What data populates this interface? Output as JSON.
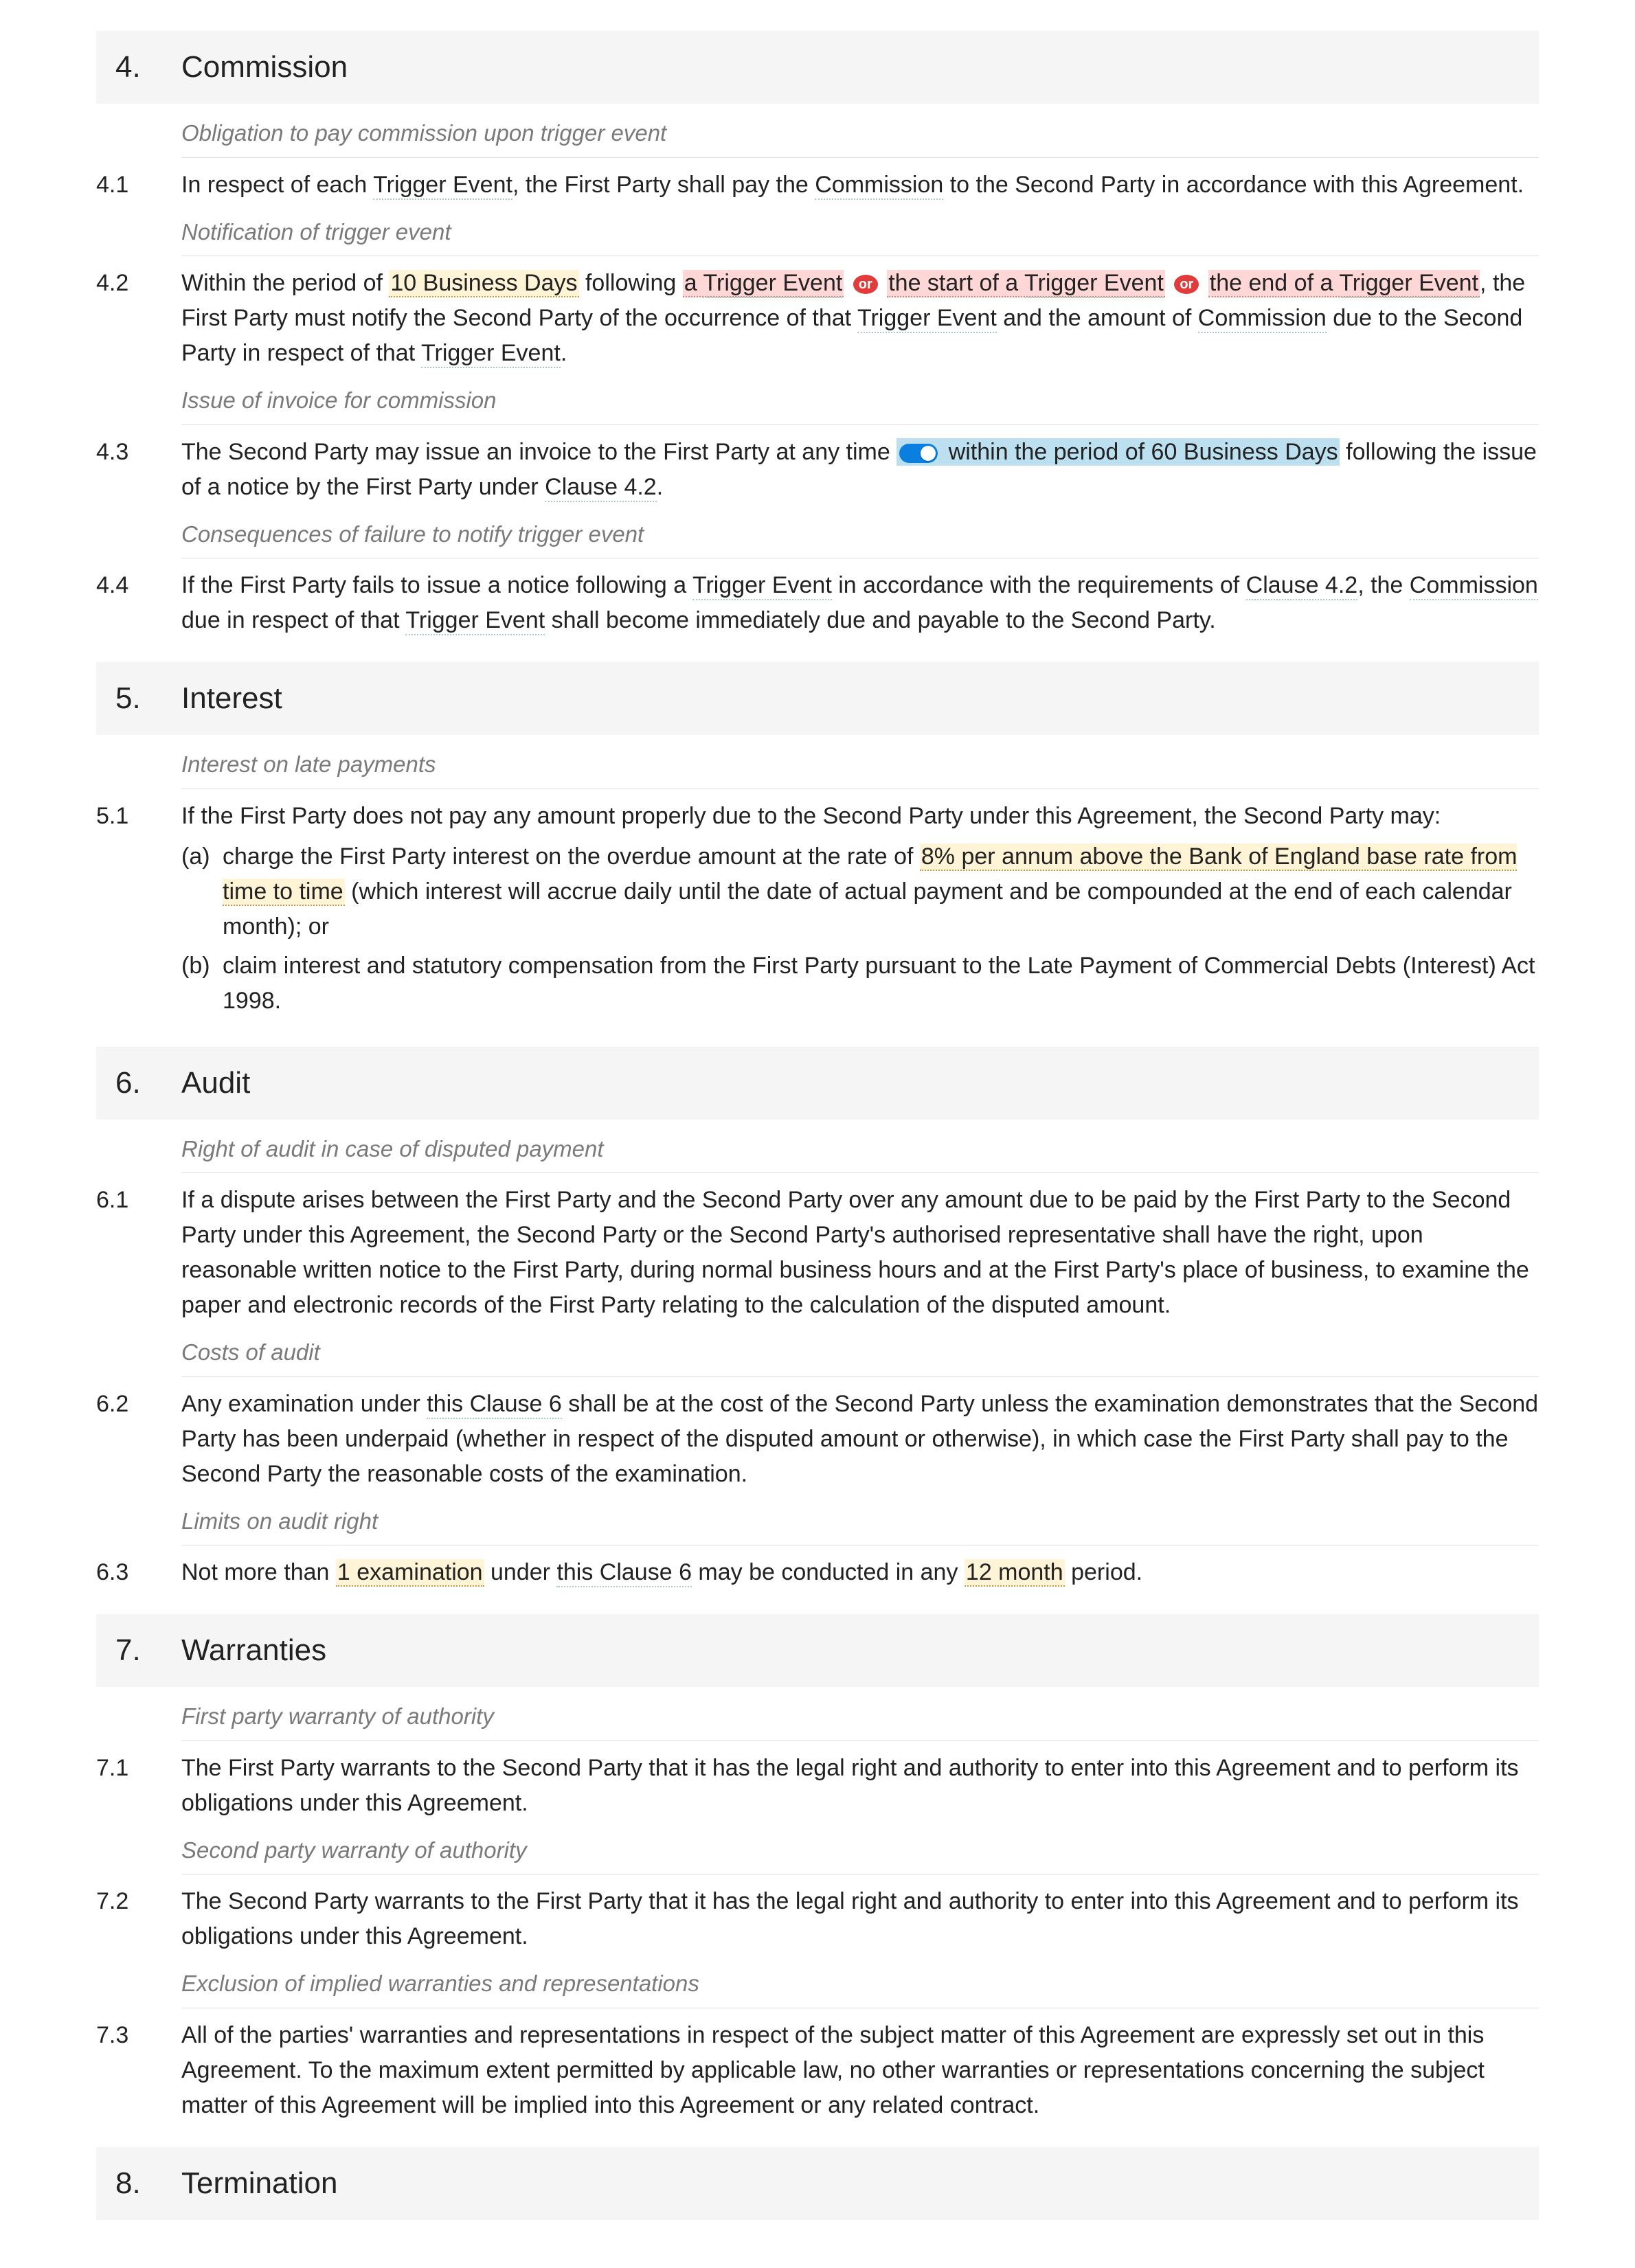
{
  "common": {
    "or_label": "or"
  },
  "s4": {
    "num": "4.",
    "title": "Commission",
    "sub_a": "Obligation to pay commission upon trigger event",
    "c1": {
      "num": "4.1",
      "t1": "In respect of each ",
      "te1": "Trigger Event",
      "t2": ", the First Party shall pay the ",
      "te2": "Commission",
      "t3": " to the Second Party in accordance with this Agreement."
    },
    "sub_b": "Notification of trigger event",
    "c2": {
      "num": "4.2",
      "t1": "Within the period of ",
      "v1": "10 Business Days",
      "t2": " following ",
      "altA_pre": "a ",
      "altA_term": "Trigger Event",
      "altB_pre": "the start of a ",
      "altB_term": "Trigger Event",
      "altC_pre": "the end of a ",
      "altC_term": "Trigger Event",
      "t3": ", the First Party must notify the Second Party of the occurrence of that ",
      "te3": "Trigger Event",
      "t4": " and the amount of ",
      "te4": "Commission",
      "t5": " due to the Second Party in respect of that ",
      "te5": "Trigger Event",
      "t6": "."
    },
    "sub_c": "Issue of invoice for commission",
    "c3": {
      "num": "4.3",
      "t1": "The Second Party may issue an invoice to the First Party at any time ",
      "opt1": "within the period of 60 Business Days",
      "t2": " following the issue of a notice by the First Party under ",
      "ref1": "Clause 4.2",
      "t3": "."
    },
    "sub_d": "Consequences of failure to notify trigger event",
    "c4": {
      "num": "4.4",
      "t1": "If the First Party fails to issue a notice following a ",
      "te1": "Trigger Event",
      "t2": " in accordance with the requirements of ",
      "ref1": "Clause 4.2",
      "t3": ", the ",
      "te2": "Commission",
      "t4": " due in respect of that ",
      "te3": "Trigger Event",
      "t5": " shall become immediately due and payable to the Second Party."
    }
  },
  "s5": {
    "num": "5.",
    "title": "Interest",
    "sub_a": "Interest on late payments",
    "c1": {
      "num": "5.1",
      "lead": "If the First Party does not pay any amount properly due to the Second Party under this Agreement, the Second Party may:",
      "a": {
        "label": "(a)",
        "t1": "charge the First Party interest on the overdue amount at the rate of ",
        "v1": "8% per annum above the Bank of England base rate from time to time",
        "t2": " (which interest will accrue daily until the date of actual payment and be compounded at the end of each calendar month); or"
      },
      "b": {
        "label": "(b)",
        "text": "claim interest and statutory compensation from the First Party pursuant to the Late Payment of Commercial Debts (Interest) Act 1998."
      }
    }
  },
  "s6": {
    "num": "6.",
    "title": "Audit",
    "sub_a": "Right of audit in case of disputed payment",
    "c1": {
      "num": "6.1",
      "text": "If a dispute arises between the First Party and the Second Party over any amount due to be paid by the First Party to the Second Party under this Agreement, the Second Party or the Second Party's authorised representative shall have the right, upon reasonable written notice to the First Party, during normal business hours and at the First Party's place of business, to examine the paper and electronic records of the First Party relating to the calculation of the disputed amount."
    },
    "sub_b": "Costs of audit",
    "c2": {
      "num": "6.2",
      "t1": "Any examination under ",
      "ref1": "this Clause 6",
      "t2": " shall be at the cost of the Second Party unless the examination demonstrates that the Second Party has been underpaid (whether in respect of the disputed amount or otherwise), in which case the First Party shall pay to the Second Party the reasonable costs of the examination."
    },
    "sub_c": "Limits on audit right",
    "c3": {
      "num": "6.3",
      "t1": "Not more than ",
      "v1": "1 examination",
      "t2": " under ",
      "ref1": "this Clause 6",
      "t3": " may be conducted in any ",
      "v2": "12 month",
      "t4": " period."
    }
  },
  "s7": {
    "num": "7.",
    "title": "Warranties",
    "sub_a": "First party warranty of authority",
    "c1": {
      "num": "7.1",
      "text": "The First Party warrants to the Second Party that it has the legal right and authority to enter into this Agreement and to perform its obligations under this Agreement."
    },
    "sub_b": "Second party warranty of authority",
    "c2": {
      "num": "7.2",
      "text": "The Second Party warrants to the First Party that it has the legal right and authority to enter into this Agreement and to perform its obligations under this Agreement."
    },
    "sub_c": "Exclusion of implied warranties and representations",
    "c3": {
      "num": "7.3",
      "text": "All of the parties' warranties and representations in respect of the subject matter of this Agreement are expressly set out in this Agreement. To the maximum extent permitted by applicable law, no other warranties or representations concerning the subject matter of this Agreement will be implied into this Agreement or any related contract."
    }
  },
  "s8": {
    "num": "8.",
    "title": "Termination"
  }
}
